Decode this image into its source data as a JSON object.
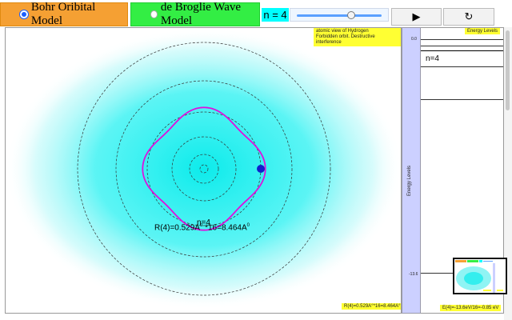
{
  "toolbar": {
    "bohr_label": "Bohr Oribital Model",
    "broglie_label": "de Broglie Wave Model",
    "n_label": "n = 4",
    "slider_value": 4,
    "play_icon": "▶",
    "reset_icon": "↻"
  },
  "simulation": {
    "info_line1": "atomic view of Hydrogen",
    "info_line2": "Forbidden orbit. Destructive interference",
    "orbit_label": "n=4",
    "radius_text": "R(4)=0.529A",
    "radius_sup": "o",
    "radius_text2": " *16=8.464A",
    "radius_sup2": "0",
    "bottom_label": "R(4)=0.529A°*16=8.464A°",
    "colors": {
      "glow": "#00f0f0",
      "wave": "#dd11dd",
      "electron": "#1020cc"
    }
  },
  "energy": {
    "axis_label": "Energy Levels",
    "title": "Energy Levels",
    "top_tick": "0.0",
    "bottom_tick": "-13.6",
    "level_label": "n=4",
    "bottom_label": "E(4)=-13.6eV/16=-0.85 eV"
  }
}
